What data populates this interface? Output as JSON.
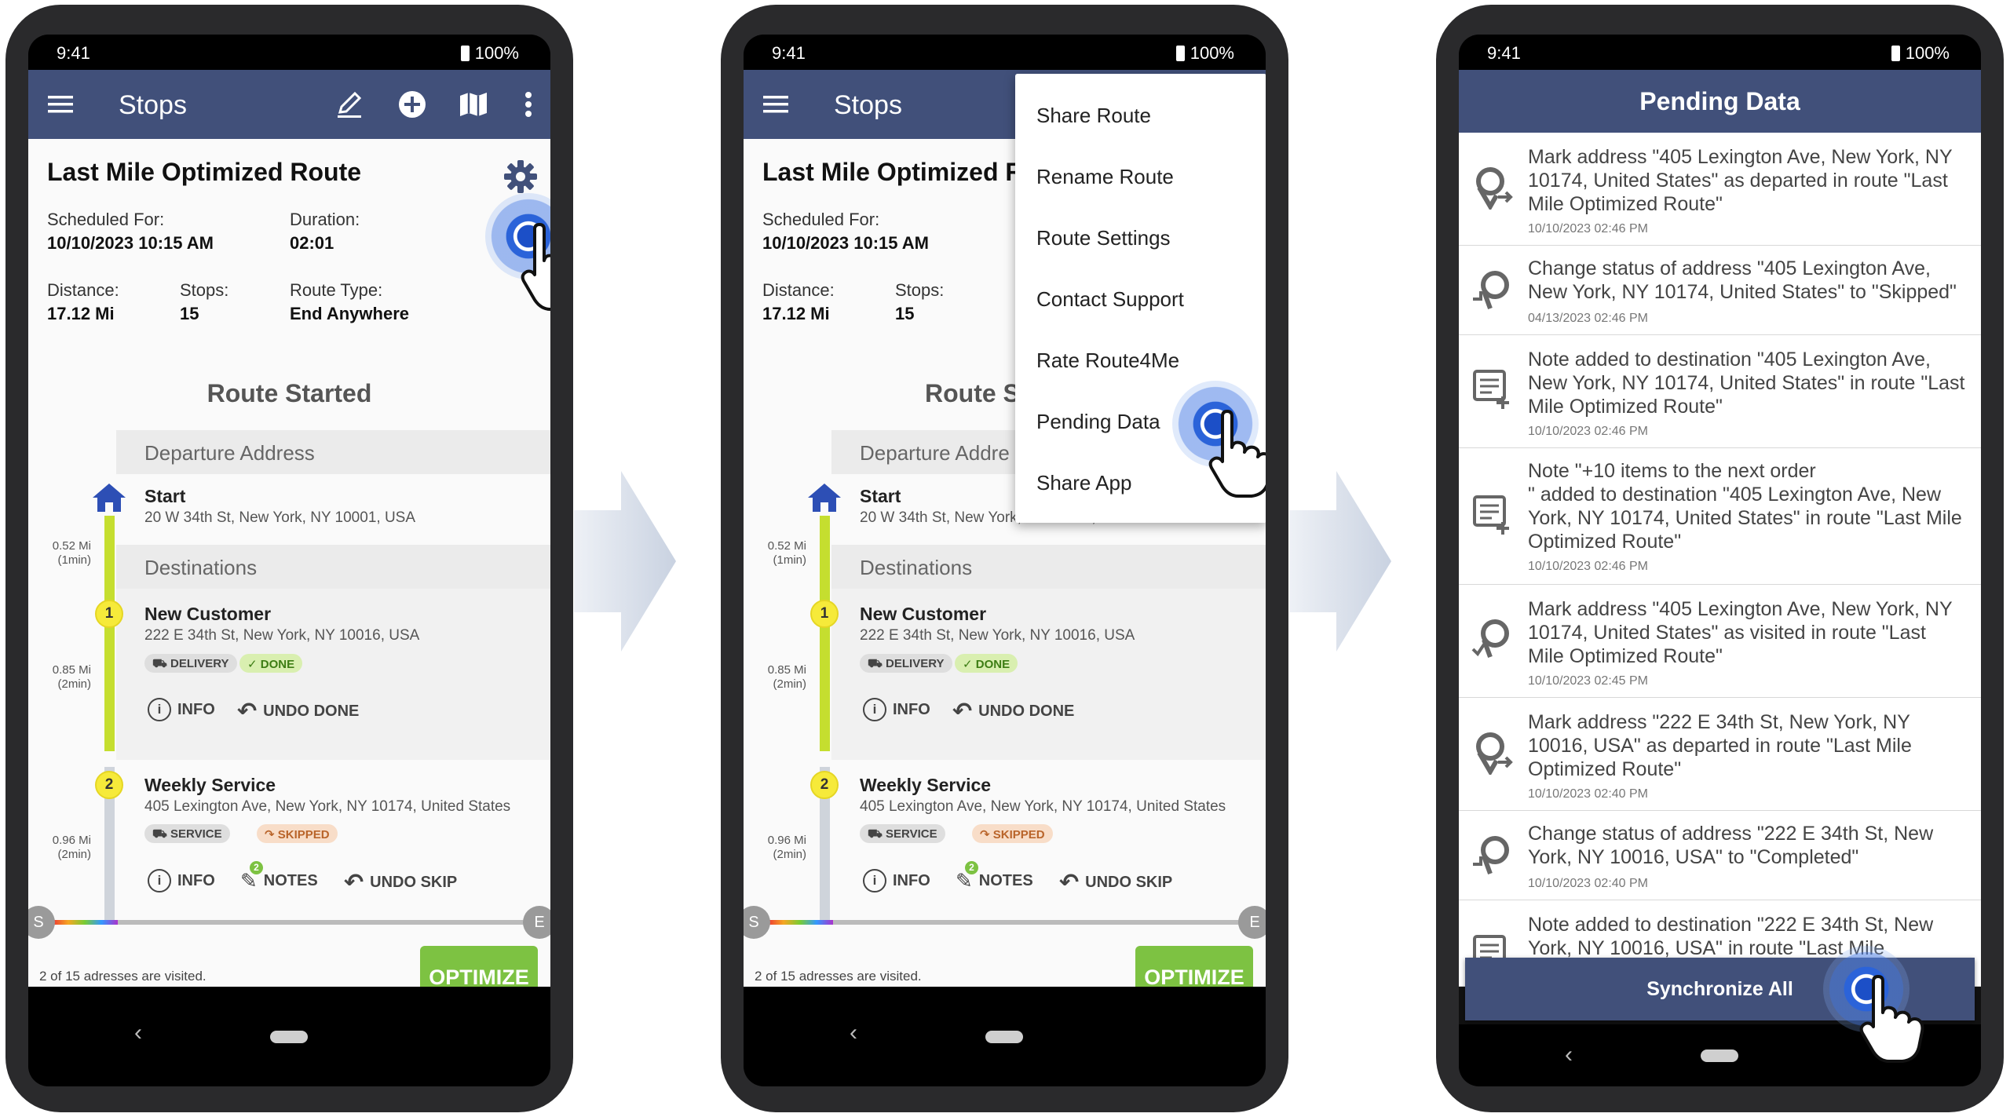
{
  "status": {
    "time": "9:41",
    "battery": "100%"
  },
  "stops_screen": {
    "app_title": "Stops",
    "route_title": "Last Mile Optimized Route",
    "route_title_clipped": "Last Mile Optimized R",
    "scheduled_label": "Scheduled For:",
    "scheduled_value": "10/10/2023  10:15 AM",
    "duration_label": "Duration:",
    "duration_value": "02:01",
    "distance_label": "Distance:",
    "distance_value": "17.12 Mi",
    "stops_label": "Stops:",
    "stops_value": "15",
    "route_type_label": "Route Type:",
    "route_type_value": "End Anywhere",
    "route_started": "Route Started",
    "route_started_clipped": "Route S",
    "departure_header": "Departure Address",
    "departure_header_clipped": "Departure Addre",
    "start_name": "Start",
    "start_address": "20 W 34th St, New York, NY 10001, USA",
    "destinations_header": "Destinations",
    "legs": [
      {
        "dist": "0.52 Mi",
        "time": "(1min)"
      },
      {
        "dist": "0.85 Mi",
        "time": "(2min)"
      },
      {
        "dist": "0.96 Mi",
        "time": "(2min)"
      }
    ],
    "stops": [
      {
        "num": "1",
        "name": "New Customer",
        "address": "222 E 34th St, New York, NY 10016, USA",
        "type": "DELIVERY",
        "status": "DONE",
        "info": "INFO",
        "undo": "UNDO DONE"
      },
      {
        "num": "2",
        "name": "Weekly Service",
        "address": "405 Lexington Ave, New York, NY 10174, United States",
        "type": "SERVICE",
        "status": "SKIPPED",
        "info": "INFO",
        "notes": "NOTES",
        "notes_badge": "2",
        "undo": "UNDO SKIP"
      }
    ],
    "slider_start": "S",
    "slider_end": "E",
    "visited_text": "2 of 15 adresses are visited.",
    "optimize_label": "OPTIMIZE"
  },
  "menu": {
    "items": [
      "Share Route",
      "Rename Route",
      "Route Settings",
      "Contact Support",
      "Rate Route4Me",
      "Pending Data",
      "Share App"
    ]
  },
  "pending_screen": {
    "title": "Pending Data",
    "items": [
      {
        "icon": "depart-pin-icon",
        "text": "Mark address \"405 Lexington Ave, New York, NY 10174, United States\" as departed in route \"Last Mile Optimized Route\"",
        "date": "10/10/2023 02:46 PM"
      },
      {
        "icon": "status-pin-icon",
        "text": "Change status of address \"405 Lexington Ave, New York, NY 10174, United States\" to \"Skipped\"",
        "date": "04/13/2023 02:46 PM"
      },
      {
        "icon": "note-icon",
        "text": "Note added to destination \"405 Lexington Ave, New York, NY 10174, United States\" in route \"Last Mile Optimized Route\"",
        "date": "10/10/2023 02:46 PM"
      },
      {
        "icon": "note-icon",
        "text": "Note \"+10 items to the next order\n\" added to destination \"405 Lexington Ave, New York, NY 10174, United States\" in route \"Last Mile Optimized Route\"",
        "date": "10/10/2023 02:46 PM"
      },
      {
        "icon": "visited-pin-icon",
        "text": "Mark address \"405 Lexington Ave, New York, NY 10174, United States\" as visited in route \"Last Mile Optimized Route\"",
        "date": "10/10/2023 02:45 PM"
      },
      {
        "icon": "depart-pin-icon",
        "text": "Mark address \"222 E 34th St, New York, NY 10016, USA\" as departed in route \"Last Mile Optimized Route\"",
        "date": "10/10/2023 02:40 PM"
      },
      {
        "icon": "status-pin-icon",
        "text": "Change status of address \"222 E 34th St, New York, NY 10016, USA\" to \"Completed\"",
        "date": "10/10/2023 02:40 PM"
      },
      {
        "icon": "note-icon",
        "text": "Note added to destination \"222 E 34th St, New York, NY 10016, USA\" in route \"Last Mile",
        "date": ""
      }
    ],
    "sync_label": "Synchronize All"
  },
  "colors": {
    "appbar": "#41507a",
    "optimize": "#7dc242",
    "tap": "#2b63d9"
  }
}
